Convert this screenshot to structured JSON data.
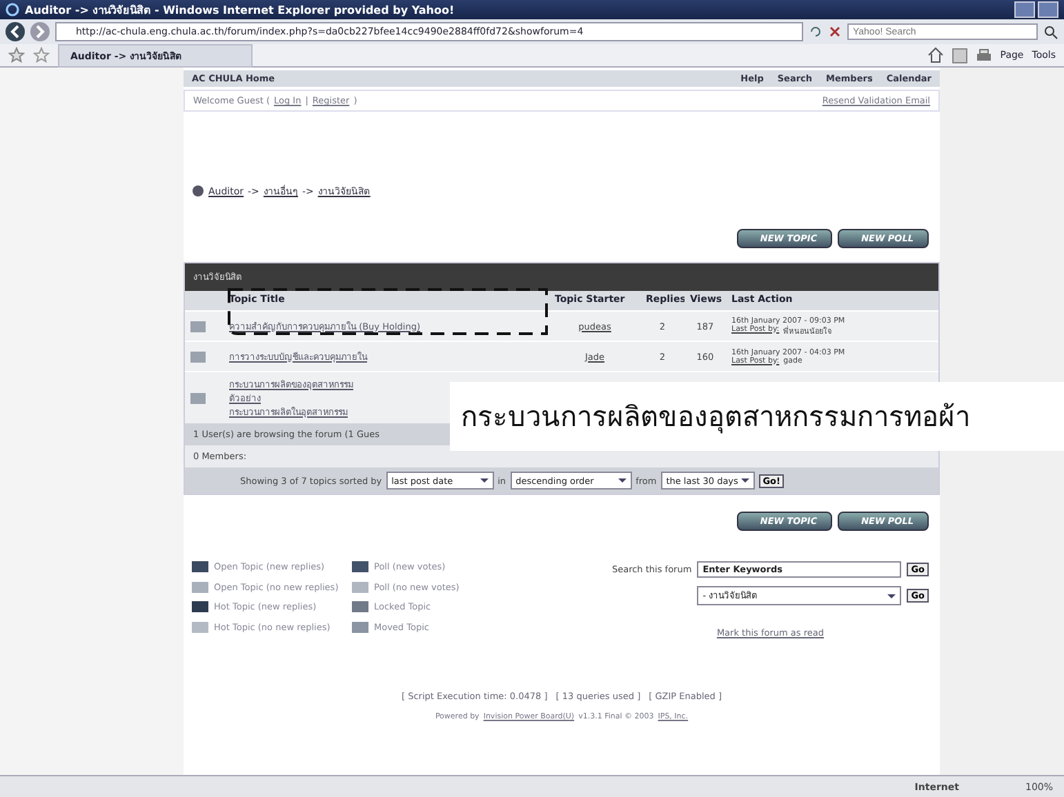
{
  "window": {
    "title": "Auditor -> งานวิจัยนิสิต - Windows Internet Explorer provided by Yahoo!"
  },
  "address_bar": {
    "url": "http://ac-chula.eng.chula.ac.th/forum/index.php?s=da0cb227bfee14cc9490e2884ff0fd72&showforum=4",
    "search_placeholder": "Yahoo! Search"
  },
  "browser_tab": {
    "label": "Auditor -> งานวิจัยนิสิต"
  },
  "command_bar": [
    "Page",
    "Tools"
  ],
  "forum": {
    "nav": {
      "home": "AC CHULA Home",
      "links": [
        "Help",
        "Search",
        "Members",
        "Calendar"
      ]
    },
    "welcome": {
      "parts": [
        {
          "kind": "text",
          "text": "Welcome Guest ("
        },
        {
          "kind": "link",
          "text": "Log In"
        },
        {
          "kind": "text",
          "text": "|"
        },
        {
          "kind": "link",
          "text": "Register"
        },
        {
          "kind": "text",
          "text": ")"
        }
      ],
      "resend": "Resend Validation Email"
    },
    "breadcrumb": {
      "items": [
        "Auditor",
        "งานอื่นๆ",
        "งานวิจัยนิสิต"
      ],
      "separator": "->"
    },
    "top_buttons": [
      "NEW TOPIC",
      "NEW POLL"
    ],
    "table": {
      "title": "งานวิจัยนิสิต",
      "columns": [
        "Topic Title",
        "Topic Starter",
        "Replies",
        "Views",
        "Last Action"
      ],
      "rows": [
        {
          "title": [
            "ความสำคัญกับการควบคุมภายใน (Buy Holding)"
          ],
          "starter": "pudeas",
          "replies": "2",
          "views": "187",
          "last_date": "16th January 2007 - 09:03 PM",
          "last_link": "Last Post by:",
          "last_by": "พี่หนอนน้อยใจ"
        },
        {
          "title": [
            "การวางระบบบัญชีและควบคุมภายใน"
          ],
          "starter": "Jade",
          "replies": "2",
          "views": "160",
          "last_date": "16th January 2007 - 04:03 PM",
          "last_link": "Last Post by:",
          "last_by": "gade"
        },
        {
          "title": [
            "กระบวนการผลิตของอุตสาหกรรม",
            "ตัวอย่าง",
            "กระบวนการผลิตในอุตสาหกรรม"
          ]
        }
      ]
    },
    "stats": {
      "browsing": "1 User(s) are browsing the forum (1 Gues",
      "members": "0 Members:"
    },
    "sort": {
      "prefix": "Showing 3 of 7 topics sorted by",
      "sort_by": "last post date",
      "in": "in",
      "order": "descending order",
      "from": "from",
      "range": "the last 30 days",
      "go": "Go!"
    },
    "bottom_buttons": [
      "NEW TOPIC",
      "NEW POLL"
    ],
    "legend": [
      {
        "kind": "new",
        "label": "Open Topic (new replies)"
      },
      {
        "kind": "nonew",
        "label": "Open Topic (no new replies)"
      },
      {
        "kind": "hot",
        "label": "Hot Topic (new replies)"
      },
      {
        "kind": "hotnonew",
        "label": "Hot Topic (no new replies)"
      },
      {
        "kind": "poll",
        "label": "Poll (new votes)"
      },
      {
        "kind": "pollnonew",
        "label": "Poll (no new votes)"
      },
      {
        "kind": "locked",
        "label": "Locked Topic"
      },
      {
        "kind": "moved",
        "label": "Moved Topic"
      }
    ],
    "search": {
      "label": "Search this forum",
      "value": "Enter Keywords",
      "go": "Go",
      "jump": "- งานวิจัยนิสิต",
      "jump_go": "Go"
    },
    "mark_read": "Mark this forum as read",
    "footer": {
      "stats": [
        "[ Script Execution time: 0.0478 ]",
        "[ 13 queries used ]",
        "[ GZIP Enabled ]"
      ],
      "powered": "Powered by",
      "product": "Invision Power Board(U)",
      "version": "v1.3.1 Final © 2003",
      "company": "IPS, Inc."
    }
  },
  "caption": "กระบวนการผลิตของอุตสาหกรรมการทอผ้า",
  "status_bar": {
    "zone": "Internet",
    "zoom": "100%"
  }
}
